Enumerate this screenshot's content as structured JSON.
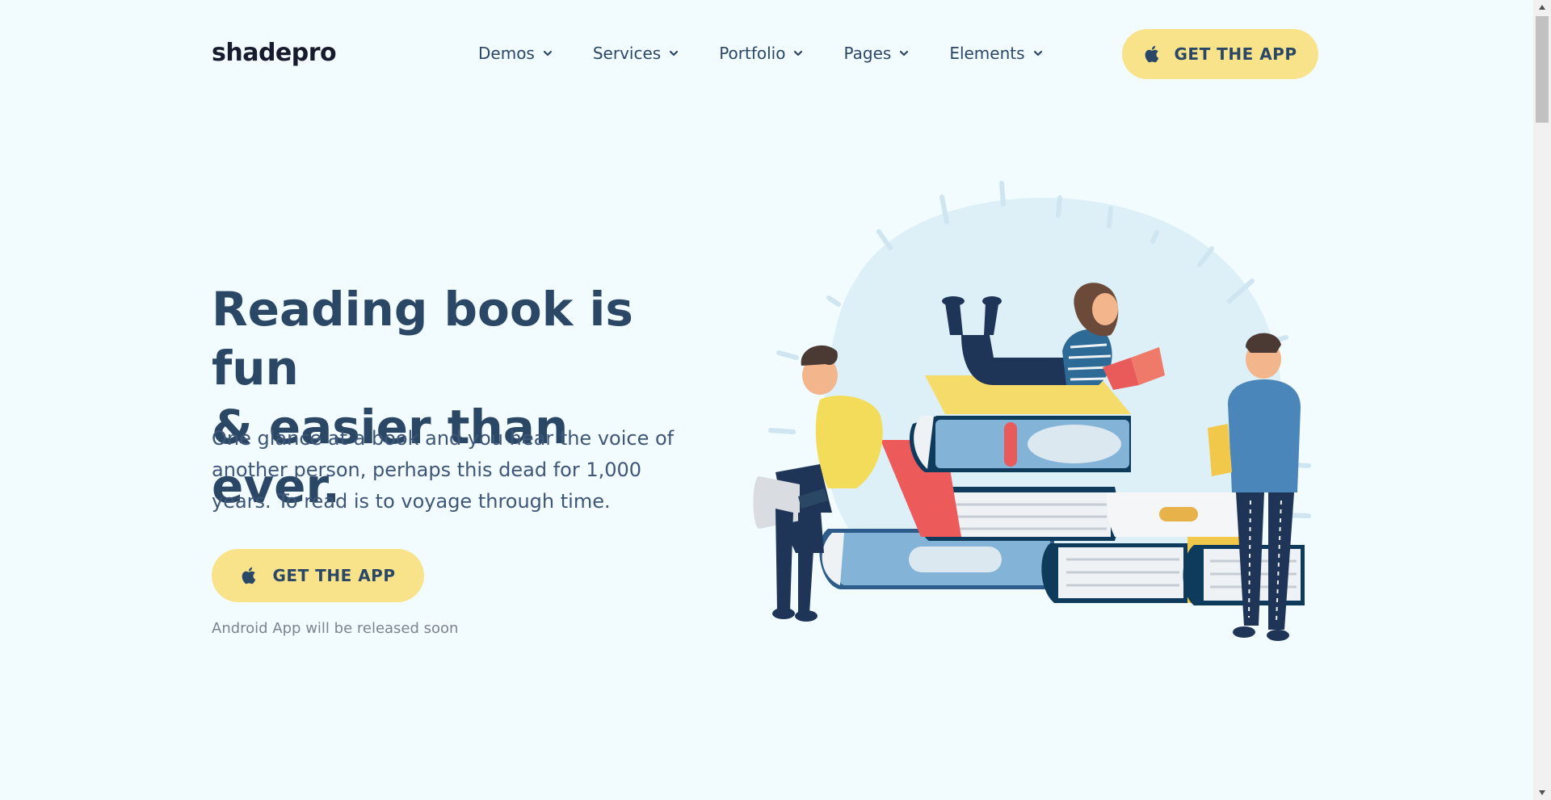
{
  "header": {
    "logo": "shadepro",
    "nav": [
      {
        "label": "Demos"
      },
      {
        "label": "Services"
      },
      {
        "label": "Portfolio"
      },
      {
        "label": "Pages"
      },
      {
        "label": "Elements"
      }
    ],
    "cta_label": "GET THE APP",
    "cta_icon": "apple-icon"
  },
  "hero": {
    "title_line1": "Reading book is fun",
    "title_line2": "& easier than ever.",
    "text": "One glance at a book and you hear the voice of another person, perhaps this dead for 1,000 years. To read is to voyage through time.",
    "cta_label": "GET THE APP",
    "note": "Android App will be released soon"
  },
  "colors": {
    "background": "#f2fbfe",
    "accent": "#f8e38a",
    "heading": "#2b4766",
    "logo": "#161c2d"
  }
}
